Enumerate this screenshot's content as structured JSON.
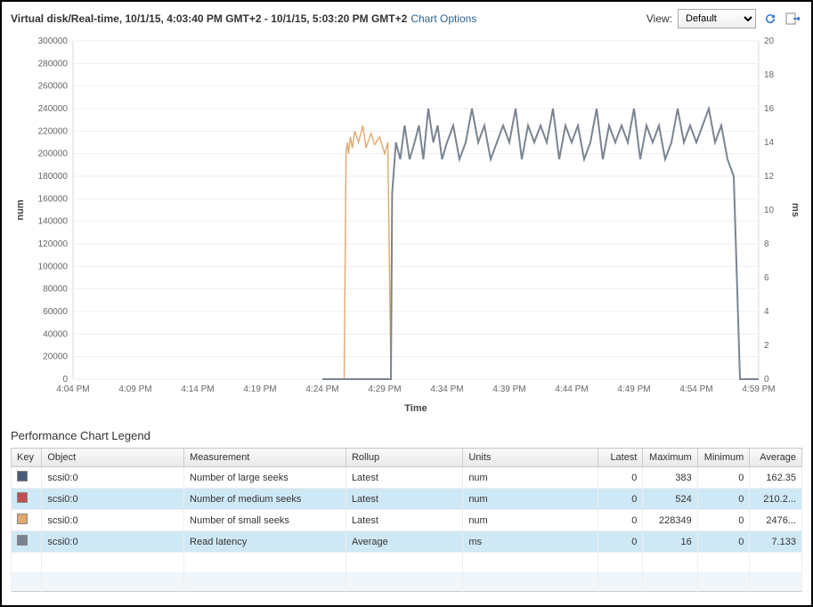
{
  "header": {
    "title": "Virtual disk/Real-time, 10/1/15, 4:03:40 PM GMT+2 - 10/1/15, 5:03:20 PM GMT+2",
    "chart_options_label": "Chart Options",
    "view_label": "View:",
    "view_value": "Default"
  },
  "chart_data": {
    "type": "line",
    "xlabel": "Time",
    "ylabel_left": "num",
    "ylabel_right": "ms",
    "x_categories": [
      "4:04 PM",
      "4:09 PM",
      "4:14 PM",
      "4:19 PM",
      "4:24 PM",
      "4:29 PM",
      "4:34 PM",
      "4:39 PM",
      "4:44 PM",
      "4:49 PM",
      "4:54 PM",
      "4:59 PM"
    ],
    "y_left_ticks": [
      0,
      20000,
      40000,
      60000,
      80000,
      100000,
      120000,
      140000,
      160000,
      180000,
      200000,
      220000,
      240000,
      260000,
      280000,
      300000
    ],
    "y_right_ticks": [
      0,
      2,
      4,
      6,
      8,
      10,
      12,
      14,
      16,
      18,
      20
    ],
    "y_left_range": [
      0,
      300000
    ],
    "y_right_range": [
      0,
      20
    ],
    "series": [
      {
        "name": "Number of large seeks",
        "object": "scsi0:0",
        "color": "#4c5a7a",
        "axis": "left",
        "values": []
      },
      {
        "name": "Number of medium seeks",
        "object": "scsi0:0",
        "color": "#c05050",
        "axis": "left",
        "values": []
      },
      {
        "name": "Number of small seeks",
        "object": "scsi0:0",
        "color": "#e0a96d",
        "axis": "left",
        "points": [
          [
            4.0,
            0
          ],
          [
            4.35,
            0
          ],
          [
            4.38,
            200000
          ],
          [
            4.4,
            210000
          ],
          [
            4.42,
            200000
          ],
          [
            4.45,
            215000
          ],
          [
            4.48,
            205000
          ],
          [
            4.52,
            220000
          ],
          [
            4.58,
            210000
          ],
          [
            4.65,
            225000
          ],
          [
            4.7,
            205000
          ],
          [
            4.78,
            218000
          ],
          [
            4.84,
            208000
          ],
          [
            4.92,
            215000
          ],
          [
            5.0,
            200000
          ],
          [
            5.05,
            210000
          ],
          [
            5.1,
            0
          ]
        ]
      },
      {
        "name": "Read latency",
        "object": "scsi0:0",
        "color": "#7a8491",
        "axis": "right",
        "points": [
          [
            4.0,
            0
          ],
          [
            5.1,
            0
          ],
          [
            5.12,
            11
          ],
          [
            5.18,
            14
          ],
          [
            5.25,
            13
          ],
          [
            5.32,
            15
          ],
          [
            5.4,
            13
          ],
          [
            5.48,
            14
          ],
          [
            5.55,
            15
          ],
          [
            5.62,
            13
          ],
          [
            5.7,
            16
          ],
          [
            5.78,
            14
          ],
          [
            5.85,
            15
          ],
          [
            5.92,
            13
          ],
          [
            6.0,
            14
          ],
          [
            6.1,
            15
          ],
          [
            6.2,
            13
          ],
          [
            6.3,
            14
          ],
          [
            6.4,
            16
          ],
          [
            6.5,
            14
          ],
          [
            6.6,
            15
          ],
          [
            6.7,
            13
          ],
          [
            6.8,
            14
          ],
          [
            6.9,
            15
          ],
          [
            7.0,
            14
          ],
          [
            7.1,
            16
          ],
          [
            7.2,
            13
          ],
          [
            7.3,
            15
          ],
          [
            7.4,
            14
          ],
          [
            7.5,
            15
          ],
          [
            7.6,
            14
          ],
          [
            7.7,
            16
          ],
          [
            7.8,
            13
          ],
          [
            7.9,
            15
          ],
          [
            8.0,
            14
          ],
          [
            8.1,
            15
          ],
          [
            8.2,
            13
          ],
          [
            8.3,
            14
          ],
          [
            8.4,
            16
          ],
          [
            8.5,
            13
          ],
          [
            8.6,
            15
          ],
          [
            8.7,
            14
          ],
          [
            8.8,
            15
          ],
          [
            8.9,
            14
          ],
          [
            9.0,
            16
          ],
          [
            9.1,
            13
          ],
          [
            9.2,
            15
          ],
          [
            9.3,
            14
          ],
          [
            9.4,
            15
          ],
          [
            9.5,
            13
          ],
          [
            9.6,
            14
          ],
          [
            9.7,
            16
          ],
          [
            9.8,
            14
          ],
          [
            9.9,
            15
          ],
          [
            10.0,
            14
          ],
          [
            10.1,
            15
          ],
          [
            10.2,
            16
          ],
          [
            10.3,
            14
          ],
          [
            10.4,
            15
          ],
          [
            10.5,
            13
          ],
          [
            10.6,
            12
          ],
          [
            10.7,
            0
          ],
          [
            11.0,
            0
          ]
        ]
      }
    ]
  },
  "legend": {
    "title": "Performance Chart Legend",
    "columns": {
      "key": "Key",
      "object": "Object",
      "measurement": "Measurement",
      "rollup": "Rollup",
      "units": "Units",
      "latest": "Latest",
      "maximum": "Maximum",
      "minimum": "Minimum",
      "average": "Average"
    },
    "rows": [
      {
        "color": "#4c5a7a",
        "object": "scsi0:0",
        "measurement": "Number of large seeks",
        "rollup": "Latest",
        "units": "num",
        "latest": "0",
        "maximum": "383",
        "minimum": "0",
        "average": "162.35",
        "selected": false
      },
      {
        "color": "#c05050",
        "object": "scsi0:0",
        "measurement": "Number of medium seeks",
        "rollup": "Latest",
        "units": "num",
        "latest": "0",
        "maximum": "524",
        "minimum": "0",
        "average": "210.2...",
        "selected": true
      },
      {
        "color": "#e0a96d",
        "object": "scsi0:0",
        "measurement": "Number of small seeks",
        "rollup": "Latest",
        "units": "num",
        "latest": "0",
        "maximum": "228349",
        "minimum": "0",
        "average": "2476...",
        "selected": false
      },
      {
        "color": "#7a8491",
        "object": "scsi0:0",
        "measurement": "Read latency",
        "rollup": "Average",
        "units": "ms",
        "latest": "0",
        "maximum": "16",
        "minimum": "0",
        "average": "7.133",
        "selected": true
      }
    ]
  }
}
